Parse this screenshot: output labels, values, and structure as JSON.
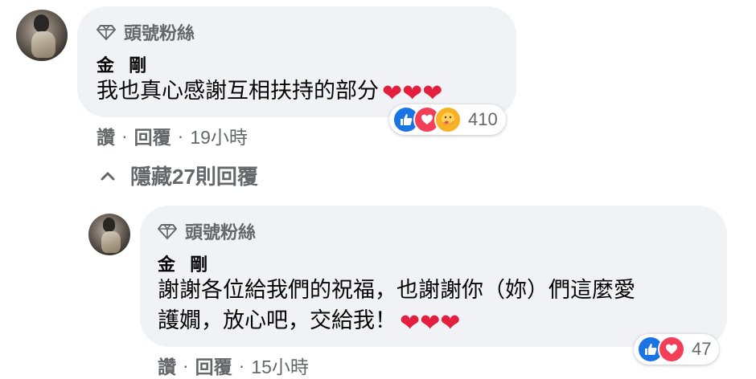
{
  "comments": [
    {
      "badge": "頭號粉絲",
      "author": "金 剛",
      "lines": [
        "我也真心感謝互相扶持的部分"
      ],
      "hearts": 3,
      "actions": {
        "like": "讚",
        "reply": "回覆",
        "time": "19小時"
      },
      "reactions": {
        "count": "410",
        "types": [
          "like-icon",
          "love-icon",
          "care-icon"
        ]
      }
    },
    {
      "badge": "頭號粉絲",
      "author": "金 剛",
      "lines": [
        "謝謝各位給我們的祝福，也謝謝你（妳）們這麼愛",
        "護嫺，放心吧，交給我！"
      ],
      "hearts": 3,
      "actions": {
        "like": "讚",
        "reply": "回覆",
        "time": "15小時"
      },
      "reactions": {
        "count": "47",
        "types": [
          "like-icon",
          "love-icon"
        ]
      }
    }
  ],
  "hide_replies": {
    "label": "隱藏27則回覆"
  },
  "colors": {
    "bubble": "#f0f2f5",
    "meta": "#65676b",
    "heart": "#e41e3f",
    "like": "#1b74e4"
  }
}
